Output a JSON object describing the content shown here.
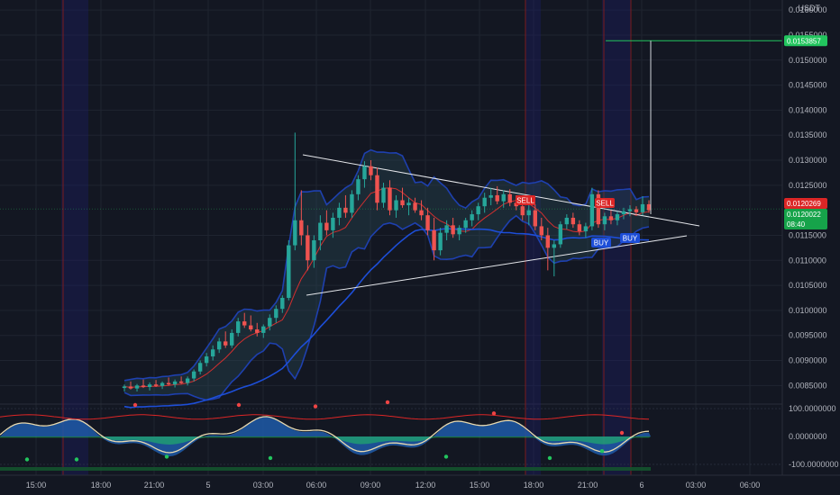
{
  "chart_data": {
    "type": "candlestick",
    "currency": "USDT",
    "price_axis": {
      "ticks": [
        "0.0160000",
        "0.0155000",
        "0.0150000",
        "0.0145000",
        "0.0140000",
        "0.0135000",
        "0.0130000",
        "0.0125000",
        "0.0115000",
        "0.0110000",
        "0.0105000",
        "0.0100000",
        "0.0095000",
        "0.0090000",
        "0.0085000"
      ],
      "ylim": [
        0.0082,
        0.0162
      ]
    },
    "oscillator_axis": {
      "ticks": [
        "100.0000000",
        "0.0000000",
        "-100.0000000"
      ]
    },
    "time_axis": [
      "15:00",
      "18:00",
      "21:00",
      "5",
      "03:00",
      "06:00",
      "09:00",
      "12:00",
      "15:00",
      "18:00",
      "21:00",
      "6",
      "03:00",
      "06:00"
    ],
    "price_labels": {
      "target": "0.0153857",
      "red": "0.0120269",
      "last": "0.0120022",
      "countdown": "08:40"
    },
    "signals": [
      "SELL",
      "SELL",
      "BUY",
      "BUY"
    ],
    "colors": {
      "bg": "#131722",
      "up": "#26a69a",
      "down": "#ef5350",
      "band": "#1e40af",
      "target": "#22c55e"
    },
    "candles": [
      [
        0.00845,
        0.00852,
        0.00838,
        0.00848
      ],
      [
        0.00848,
        0.00858,
        0.00842,
        0.00844
      ],
      [
        0.00844,
        0.00853,
        0.00838,
        0.0085
      ],
      [
        0.0085,
        0.00862,
        0.00845,
        0.00847
      ],
      [
        0.00847,
        0.00856,
        0.0084,
        0.00852
      ],
      [
        0.00852,
        0.00861,
        0.00847,
        0.00849
      ],
      [
        0.00849,
        0.00858,
        0.00843,
        0.00855
      ],
      [
        0.00855,
        0.00866,
        0.0085,
        0.00852
      ],
      [
        0.00852,
        0.00862,
        0.00846,
        0.00858
      ],
      [
        0.00858,
        0.00868,
        0.00853,
        0.00855
      ],
      [
        0.00855,
        0.00868,
        0.0085,
        0.00864
      ],
      [
        0.00864,
        0.00882,
        0.00858,
        0.00878
      ],
      [
        0.00878,
        0.009,
        0.00872,
        0.00895
      ],
      [
        0.00895,
        0.00915,
        0.00888,
        0.00908
      ],
      [
        0.00908,
        0.0093,
        0.009,
        0.00922
      ],
      [
        0.00922,
        0.00945,
        0.00915,
        0.00938
      ],
      [
        0.00938,
        0.00958,
        0.00925,
        0.0093
      ],
      [
        0.0093,
        0.00962,
        0.00925,
        0.00955
      ],
      [
        0.00955,
        0.00985,
        0.00948,
        0.00978
      ],
      [
        0.00978,
        0.00995,
        0.00965,
        0.0097
      ],
      [
        0.0097,
        0.0099,
        0.00958,
        0.00962
      ],
      [
        0.00962,
        0.00975,
        0.00948,
        0.00955
      ],
      [
        0.00955,
        0.00972,
        0.00945,
        0.00968
      ],
      [
        0.00968,
        0.00992,
        0.0096,
        0.00985
      ],
      [
        0.00985,
        0.0101,
        0.00975,
        0.01003
      ],
      [
        0.01003,
        0.0103,
        0.00995,
        0.01025
      ],
      [
        0.01025,
        0.0114,
        0.0102,
        0.0113
      ],
      [
        0.0113,
        0.01355,
        0.0112,
        0.0118
      ],
      [
        0.0118,
        0.0124,
        0.0113,
        0.0115
      ],
      [
        0.0115,
        0.0117,
        0.0108,
        0.011
      ],
      [
        0.011,
        0.0115,
        0.01085,
        0.0114
      ],
      [
        0.0114,
        0.0119,
        0.0112,
        0.01175
      ],
      [
        0.01175,
        0.012,
        0.0115,
        0.0116
      ],
      [
        0.0116,
        0.01195,
        0.01145,
        0.01185
      ],
      [
        0.01185,
        0.01215,
        0.0117,
        0.01205
      ],
      [
        0.01205,
        0.0123,
        0.01185,
        0.01195
      ],
      [
        0.01195,
        0.0124,
        0.01185,
        0.01232
      ],
      [
        0.01232,
        0.0127,
        0.0122,
        0.01262
      ],
      [
        0.01262,
        0.01298,
        0.01245,
        0.01288
      ],
      [
        0.01288,
        0.013,
        0.0126,
        0.0127
      ],
      [
        0.0127,
        0.01285,
        0.012,
        0.01215
      ],
      [
        0.01215,
        0.01255,
        0.01205,
        0.01245
      ],
      [
        0.01245,
        0.0126,
        0.0119,
        0.012
      ],
      [
        0.012,
        0.0123,
        0.01185,
        0.0122
      ],
      [
        0.0122,
        0.01245,
        0.01205,
        0.0121
      ],
      [
        0.0121,
        0.01225,
        0.0119,
        0.01215
      ],
      [
        0.01215,
        0.01225,
        0.01195,
        0.012
      ],
      [
        0.012,
        0.0122,
        0.0118,
        0.0119
      ],
      [
        0.0119,
        0.01205,
        0.0115,
        0.0116
      ],
      [
        0.0116,
        0.01185,
        0.011,
        0.0112
      ],
      [
        0.0112,
        0.01165,
        0.0111,
        0.01155
      ],
      [
        0.01155,
        0.0118,
        0.0114,
        0.0117
      ],
      [
        0.0117,
        0.01185,
        0.01145,
        0.01152
      ],
      [
        0.01152,
        0.0117,
        0.0114,
        0.01165
      ],
      [
        0.01165,
        0.01185,
        0.01155,
        0.0118
      ],
      [
        0.0118,
        0.012,
        0.01168,
        0.01192
      ],
      [
        0.01192,
        0.01215,
        0.0118,
        0.01208
      ],
      [
        0.01208,
        0.01235,
        0.01195,
        0.01225
      ],
      [
        0.01225,
        0.01245,
        0.0121,
        0.0123
      ],
      [
        0.0123,
        0.01248,
        0.01212,
        0.01218
      ],
      [
        0.01218,
        0.0124,
        0.01205,
        0.01232
      ],
      [
        0.01232,
        0.01242,
        0.01208,
        0.01215
      ],
      [
        0.01215,
        0.0123,
        0.012,
        0.01208
      ],
      [
        0.01208,
        0.0122,
        0.0118,
        0.0119
      ],
      [
        0.0119,
        0.0121,
        0.0117,
        0.012
      ],
      [
        0.012,
        0.01212,
        0.0116,
        0.01168
      ],
      [
        0.01168,
        0.01185,
        0.0114,
        0.0115
      ],
      [
        0.0115,
        0.01165,
        0.0108,
        0.01125
      ],
      [
        0.01125,
        0.0114,
        0.01068,
        0.01132
      ],
      [
        0.01132,
        0.01178,
        0.01125,
        0.01172
      ],
      [
        0.01172,
        0.01192,
        0.01162,
        0.01185
      ],
      [
        0.01185,
        0.01195,
        0.01165,
        0.01172
      ],
      [
        0.01172,
        0.0118,
        0.0115,
        0.01158
      ],
      [
        0.01158,
        0.01175,
        0.01145,
        0.01168
      ],
      [
        0.01168,
        0.01245,
        0.0116,
        0.01232
      ],
      [
        0.01232,
        0.0124,
        0.01165,
        0.01172
      ],
      [
        0.01172,
        0.01195,
        0.0116,
        0.01188
      ],
      [
        0.01188,
        0.012,
        0.01172,
        0.0118
      ],
      [
        0.0118,
        0.01198,
        0.0117,
        0.01192
      ],
      [
        0.01192,
        0.01205,
        0.01182,
        0.01198
      ],
      [
        0.01198,
        0.0121,
        0.01188,
        0.01202
      ],
      [
        0.01202,
        0.01208,
        0.0119,
        0.01196
      ],
      [
        0.01196,
        0.01228,
        0.0119,
        0.01212
      ],
      [
        0.01212,
        0.0122,
        0.01195,
        0.012
      ]
    ]
  }
}
